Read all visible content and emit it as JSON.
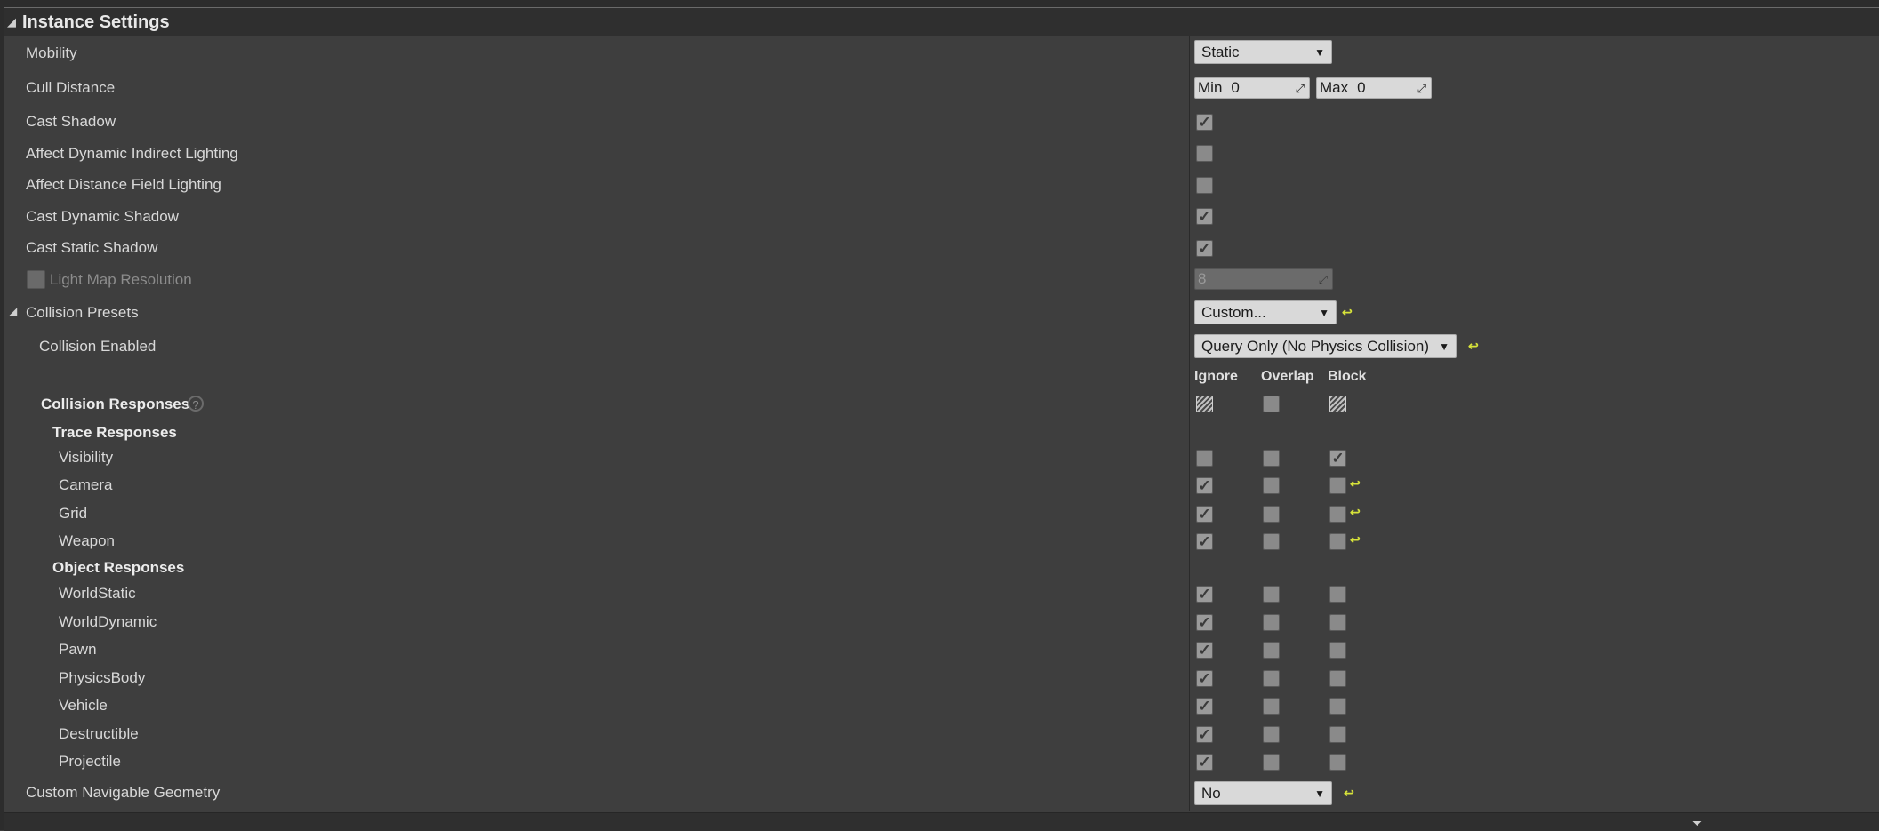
{
  "section": {
    "title": "Instance Settings"
  },
  "rows": {
    "mobility": {
      "label": "Mobility",
      "value": "Static"
    },
    "cull_distance": {
      "label": "Cull Distance",
      "min_prefix": "Min",
      "min_value": "0",
      "max_prefix": "Max",
      "max_value": "0"
    },
    "cast_shadow": {
      "label": "Cast Shadow",
      "checked": true
    },
    "affect_dynamic_indirect_lighting": {
      "label": "Affect Dynamic Indirect Lighting",
      "checked": false
    },
    "affect_distance_field_lighting": {
      "label": "Affect Distance Field Lighting",
      "checked": false
    },
    "cast_dynamic_shadow": {
      "label": "Cast Dynamic Shadow",
      "checked": true
    },
    "cast_static_shadow": {
      "label": "Cast Static Shadow",
      "checked": true
    },
    "light_map_resolution": {
      "label": "Light Map Resolution",
      "value": "8",
      "enabled": false
    },
    "collision_presets": {
      "label": "Collision Presets",
      "value": "Custom..."
    },
    "collision_enabled": {
      "label": "Collision Enabled",
      "value": "Query Only (No Physics Collision)"
    },
    "custom_navigable_geometry": {
      "label": "Custom Navigable Geometry",
      "value": "No"
    }
  },
  "collision_responses": {
    "label": "Collision Responses",
    "columns": [
      "Ignore",
      "Overlap",
      "Block"
    ],
    "trace_header": "Trace Responses",
    "trace": [
      {
        "name": "Visibility",
        "ignore": false,
        "overlap": false,
        "block": true
      },
      {
        "name": "Camera",
        "ignore": true,
        "overlap": false,
        "block": false
      },
      {
        "name": "Grid",
        "ignore": true,
        "overlap": false,
        "block": false
      },
      {
        "name": "Weapon",
        "ignore": true,
        "overlap": false,
        "block": false
      }
    ],
    "object_header": "Object Responses",
    "object": [
      {
        "name": "WorldStatic",
        "ignore": true,
        "overlap": false,
        "block": false
      },
      {
        "name": "WorldDynamic",
        "ignore": true,
        "overlap": false,
        "block": false
      },
      {
        "name": "Pawn",
        "ignore": true,
        "overlap": false,
        "block": false
      },
      {
        "name": "PhysicsBody",
        "ignore": true,
        "overlap": false,
        "block": false
      },
      {
        "name": "Vehicle",
        "ignore": true,
        "overlap": false,
        "block": false
      },
      {
        "name": "Destructible",
        "ignore": true,
        "overlap": false,
        "block": false
      },
      {
        "name": "Projectile",
        "ignore": true,
        "overlap": false,
        "block": false
      }
    ]
  },
  "icons": {
    "collapse": "triangle-down-icon",
    "reset": "reset-to-default-icon",
    "help": "help-icon",
    "dropdown": "chevron-down-icon"
  }
}
